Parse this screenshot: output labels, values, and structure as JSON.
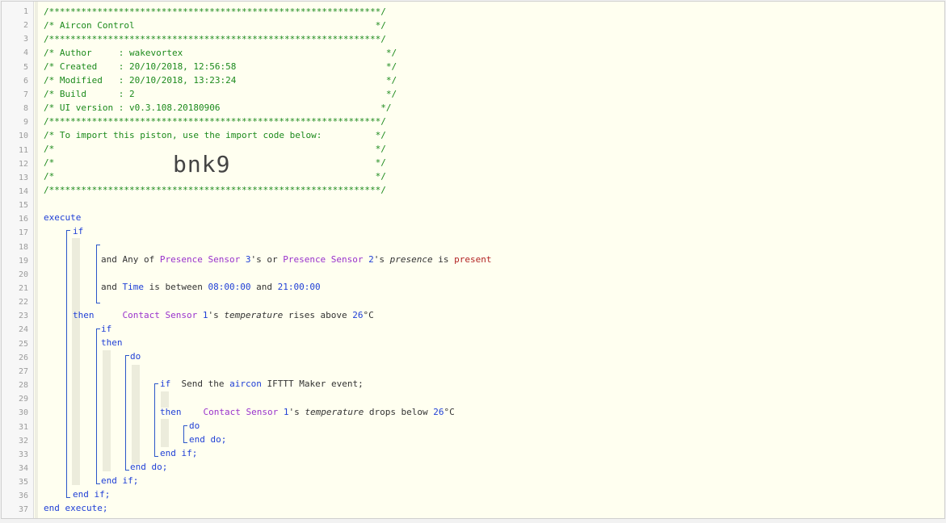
{
  "line_numbers": [
    "1",
    "2",
    "3",
    "4",
    "5",
    "6",
    "7",
    "8",
    "9",
    "10",
    "11",
    "12",
    "13",
    "14",
    "15",
    "16",
    "17",
    "18",
    "19",
    "20",
    "21",
    "22",
    "23",
    "24",
    "25",
    "26",
    "27",
    "28",
    "29",
    "30",
    "31",
    "32",
    "33",
    "34",
    "35",
    "36",
    "37"
  ],
  "header": {
    "stars_line": "/**************************************************************/",
    "title_line": "/* Aircon Control                                             */",
    "author_line": "/* Author     : wakevortex                                      */",
    "created_line": "/* Created    : 20/10/2018, 12:56:58                            */",
    "modified_line": "/* Modified   : 20/10/2018, 13:23:24                            */",
    "build_line": "/* Build      : 2                                               */",
    "ui_line": "/* UI version : v0.3.108.20180906                              */",
    "import_line": "/* To import this piston, use the import code below:          */",
    "empty_line": "/*                                                            */",
    "import_code": "bnk9"
  },
  "code": {
    "execute": "execute",
    "end_execute": "end execute;",
    "if": "if",
    "then": "then",
    "do": "do",
    "end_do": "end do;",
    "end_if": "end if;",
    "and": "and",
    "cond1": {
      "any_of": "Any of ",
      "dev1": "Presence Sensor ",
      "dev1_idx": "3",
      "s_or": "'s or ",
      "dev2": "Presence Sensor ",
      "dev2_idx": "2",
      "s": "'s ",
      "attr": "presence",
      "is": " is ",
      "value": "present"
    },
    "cond2": {
      "var": "Time",
      "between": " is between ",
      "from": "08:00:00",
      "and": " and ",
      "to": "21:00:00"
    },
    "cond3": {
      "dev": "Contact Sensor ",
      "idx": "1",
      "s": "'s ",
      "attr": "temperature",
      "op": " rises above ",
      "value": "26",
      "unit": "°C"
    },
    "send": {
      "pre": "Send the ",
      "event": "aircon",
      "post": " IFTTT Maker event;"
    },
    "cond4": {
      "dev": "Contact Sensor ",
      "idx": "1",
      "s": "'s ",
      "attr": "temperature",
      "op": " drops below ",
      "value": "26",
      "unit": "°C"
    }
  }
}
